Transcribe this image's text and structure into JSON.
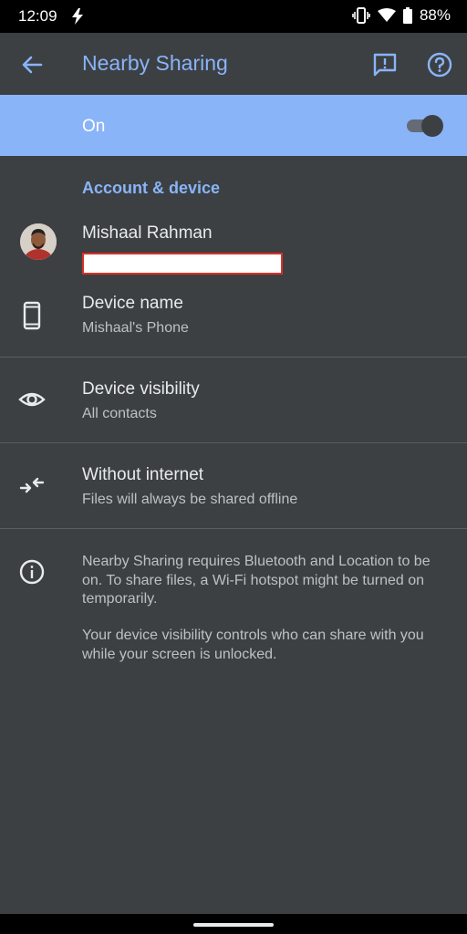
{
  "status_bar": {
    "time": "12:09",
    "battery": "88%",
    "icons": [
      "flash-icon",
      "vibrate-icon",
      "wifi-icon",
      "battery-icon"
    ]
  },
  "app_bar": {
    "title": "Nearby Sharing",
    "icons": [
      "back-arrow-icon",
      "feedback-icon",
      "help-icon"
    ]
  },
  "main_toggle": {
    "label": "On",
    "enabled": true
  },
  "section": {
    "header": "Account & device"
  },
  "account": {
    "name": "Mishaal Rahman"
  },
  "settings": [
    {
      "title": "Device name",
      "subtitle": "Mishaal's Phone",
      "icon": "phone-icon"
    },
    {
      "title": "Device visibility",
      "subtitle": "All contacts",
      "icon": "eye-icon"
    },
    {
      "title": "Without internet",
      "subtitle": "Files will always be shared offline",
      "icon": "offline-arrows-icon"
    }
  ],
  "info": {
    "icon": "info-icon",
    "paragraph1": "Nearby Sharing requires Bluetooth and Location to be on. To share files, a Wi-Fi hotspot might be turned on temporarily.",
    "paragraph2": "Your device visibility controls who can share with you while your screen is unlocked."
  },
  "colors": {
    "accent": "#8ab4f8",
    "background": "#3c4043",
    "text_primary": "#e8eaed",
    "text_secondary": "#bdc1c6"
  }
}
